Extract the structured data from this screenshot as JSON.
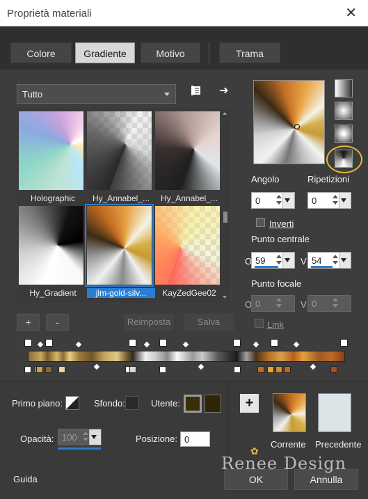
{
  "window": {
    "title": "Proprietà materiali",
    "close_glyph": "✕"
  },
  "tabs": [
    {
      "label": "Colore",
      "active": false
    },
    {
      "label": "Gradiente",
      "active": true
    },
    {
      "label": "Motivo",
      "active": false
    },
    {
      "label": "Trama",
      "active": false
    }
  ],
  "library": {
    "category": "Tutto",
    "icons": [
      "library-icon",
      "arrow-right-icon"
    ]
  },
  "gradients": [
    {
      "name": "Holographic",
      "selected": false
    },
    {
      "name": "Hy_Annabel_...",
      "selected": false
    },
    {
      "name": "Hy_Annabel_...",
      "selected": false
    },
    {
      "name": "Hy_Gradient",
      "selected": false
    },
    {
      "name": "jlm-gold-silv...",
      "selected": true
    },
    {
      "name": "KayZedGee02",
      "selected": false
    }
  ],
  "gallery_buttons": {
    "add": "+",
    "remove": "-",
    "reset": "Reimposta",
    "save": "Salva"
  },
  "style": {
    "angle_label": "Angolo",
    "angle_value": "0",
    "repeat_label": "Ripetizioni",
    "repeat_value": "0",
    "invert_label": "Inverti",
    "center_label": "Punto centrale",
    "center_h_label": "O",
    "center_h_value": "59",
    "center_v_label": "V",
    "center_v_value": "54",
    "focal_label": "Punto focale",
    "focal_h_label": "O",
    "focal_h_value": "0",
    "focal_v_label": "V",
    "focal_v_value": "0",
    "link_label": "Link"
  },
  "bottom": {
    "foreground_label": "Primo piano:",
    "background_label": "Sfondo:",
    "user_label": "Utente:",
    "opacity_label": "Opacità:",
    "opacity_value": "100",
    "position_label": "Posizione:",
    "position_value": "0",
    "current_label": "Corrente",
    "previous_label": "Precedente",
    "plus_glyph": "+"
  },
  "footer": {
    "help": "Guida",
    "ok": "OK",
    "cancel": "Annulla",
    "watermark": "Renee Design"
  },
  "colors": {
    "accent": "#2a7fd4",
    "highlight": "#e8b82c",
    "user_swatch": "#3a2e06"
  }
}
